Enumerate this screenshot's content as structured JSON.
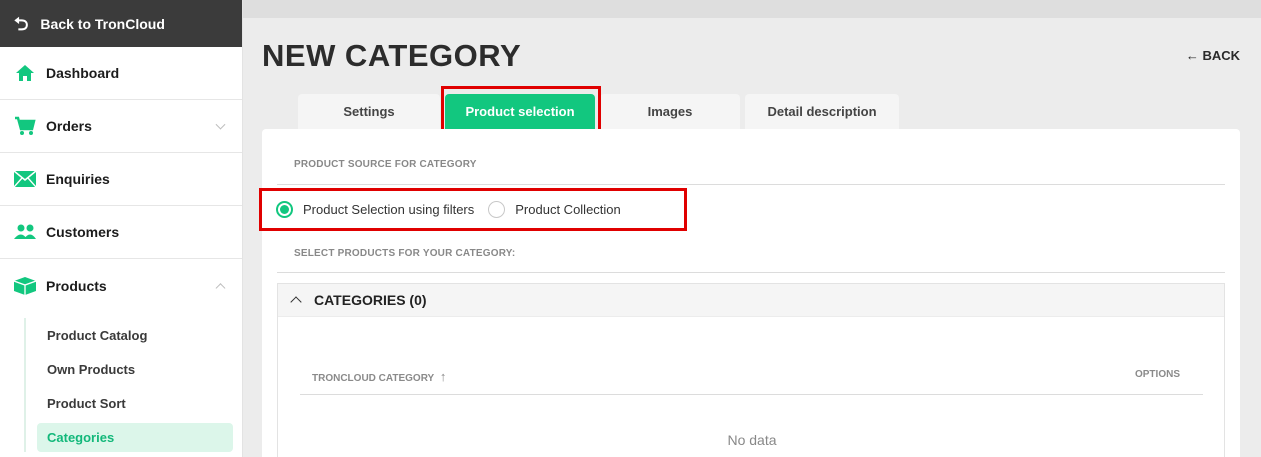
{
  "sidebar": {
    "back_label": "Back to TronCloud",
    "items": [
      {
        "label": "Dashboard",
        "icon": "home-icon"
      },
      {
        "label": "Orders",
        "icon": "cart-icon"
      },
      {
        "label": "Enquiries",
        "icon": "envelope-icon"
      },
      {
        "label": "Customers",
        "icon": "users-icon"
      },
      {
        "label": "Products",
        "icon": "box-icon"
      }
    ],
    "sub_items": [
      "Product Catalog",
      "Own Products",
      "Product Sort",
      "Categories"
    ],
    "active_sub": "Categories"
  },
  "header": {
    "title": "NEW CATEGORY",
    "back_link": "← BACK"
  },
  "tabs": [
    "Settings",
    "Product selection",
    "Images",
    "Detail description"
  ],
  "active_tab": "Product selection",
  "source": {
    "label": "PRODUCT SOURCE FOR CATEGORY",
    "options": [
      "Product Selection using filters",
      "Product Collection"
    ],
    "selected": "Product Selection using filters"
  },
  "select_label": "SELECT PRODUCTS FOR YOUR CATEGORY:",
  "categories_panel": {
    "title": "CATEGORIES (0)",
    "col_category": "TRONCLOUD CATEGORY",
    "col_options": "OPTIONS",
    "empty": "No data"
  },
  "colors": {
    "accent": "#12c77f",
    "highlight": "#e00000",
    "sidebar_dark": "#3b3b3b"
  }
}
